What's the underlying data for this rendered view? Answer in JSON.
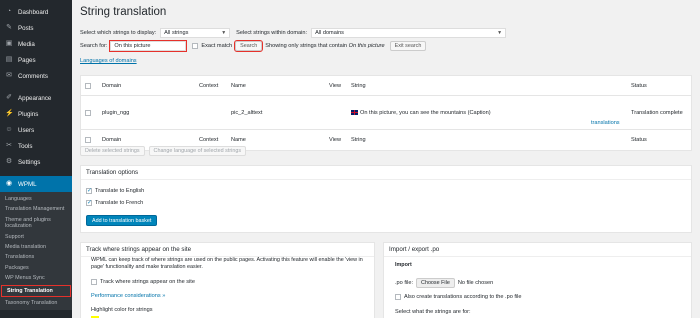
{
  "sidebar": {
    "items": [
      {
        "label": "Dashboard",
        "icon": "dashboard-icon",
        "glyph": "◔"
      },
      {
        "label": "Posts",
        "icon": "pin-icon",
        "glyph": "✎"
      },
      {
        "label": "Media",
        "icon": "media-icon",
        "glyph": "▣"
      },
      {
        "label": "Pages",
        "icon": "pages-icon",
        "glyph": "▤"
      },
      {
        "label": "Comments",
        "icon": "comments-icon",
        "glyph": "✉"
      },
      {
        "label": "Appearance",
        "icon": "brush-icon",
        "glyph": "✐"
      },
      {
        "label": "Plugins",
        "icon": "plug-icon",
        "glyph": "⚡"
      },
      {
        "label": "Users",
        "icon": "users-icon",
        "glyph": "☺"
      },
      {
        "label": "Tools",
        "icon": "wrench-icon",
        "glyph": "✂"
      },
      {
        "label": "Settings",
        "icon": "settings-icon",
        "glyph": "⚙"
      }
    ],
    "wpml": {
      "label": "WPML",
      "glyph": "◉"
    },
    "submenu": [
      "Languages",
      "Translation Management",
      "Theme and plugins localization",
      "Support",
      "Media translation",
      "Translations",
      "Packages",
      "WP Menus Sync",
      "String Translation",
      "Taxonomy Translation"
    ]
  },
  "page": {
    "title": "String translation"
  },
  "filters": {
    "display_label": "Select which strings to display:",
    "display_value": "All strings",
    "domain_label": "Select strings within domain:",
    "domain_value": "All domains",
    "search_label": "Search for:",
    "search_value": "On this picture",
    "exact_label": "Exact match",
    "search_button": "Search",
    "showing_prefix": "Showing only strings that contain",
    "showing_term": "On this picture",
    "exit_button": "Exit search",
    "languages_link": "Languages of domains"
  },
  "table": {
    "headers": {
      "domain": "Domain",
      "context": "Context",
      "name": "Name",
      "view": "View",
      "string": "String",
      "status": "Status"
    },
    "rows": [
      {
        "domain": "plugin_ngg",
        "context": "",
        "name": "pic_2_alttext",
        "string": "On this picture, you can see the mountains (Caption)",
        "translations": "translations",
        "status": "Translation complete"
      }
    ]
  },
  "actions": {
    "delete": "Delete selected strings",
    "change_language": "Change language of selected strings"
  },
  "translation_options": {
    "title": "Translation options",
    "english": "Translate to English",
    "french": "Translate to French",
    "add_button": "Add to translation basket"
  },
  "track": {
    "title": "Track where strings appear on the site",
    "description": "WPML can keep track of where strings are used on the public pages. Activating this feature will enable the 'view in page' functionality and make translation easier.",
    "checkbox": "Track where strings appear on the site",
    "perf_link": "Performance considerations »",
    "highlight": "Highlight color for strings"
  },
  "import": {
    "title": "Import / export .po",
    "import_label": "Import",
    "po_file_label": ".po file:",
    "choose_file": "Choose File",
    "no_file": "No file chosen",
    "also_create": "Also create translations according to the .po file",
    "select_what": "Select what the strings are for:"
  },
  "colors": {
    "sidebar_bg": "#23282d",
    "active": "#0073aa",
    "highlight": "#e6312b",
    "highlight_swatch": "#ffff00"
  }
}
